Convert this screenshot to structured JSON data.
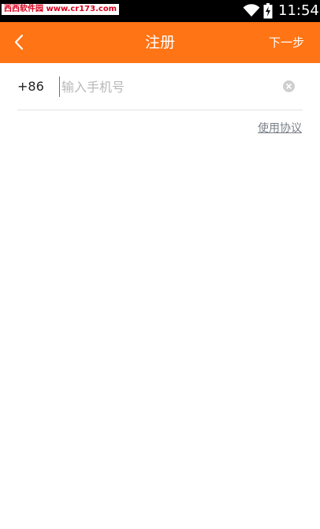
{
  "status_bar": {
    "watermark": "西西软件园 www.cr173.com",
    "time": "11:54",
    "icons": [
      "wifi-icon",
      "battery-charging-icon"
    ]
  },
  "app_bar": {
    "title": "注册",
    "next_label": "下一步",
    "back_icon": "chevron-left-icon",
    "background_color": "#ff7415"
  },
  "form": {
    "country_code": "+86",
    "phone_value": "",
    "phone_placeholder": "输入手机号",
    "clear_icon": "clear-circle-icon"
  },
  "agreement_link": "使用协议"
}
